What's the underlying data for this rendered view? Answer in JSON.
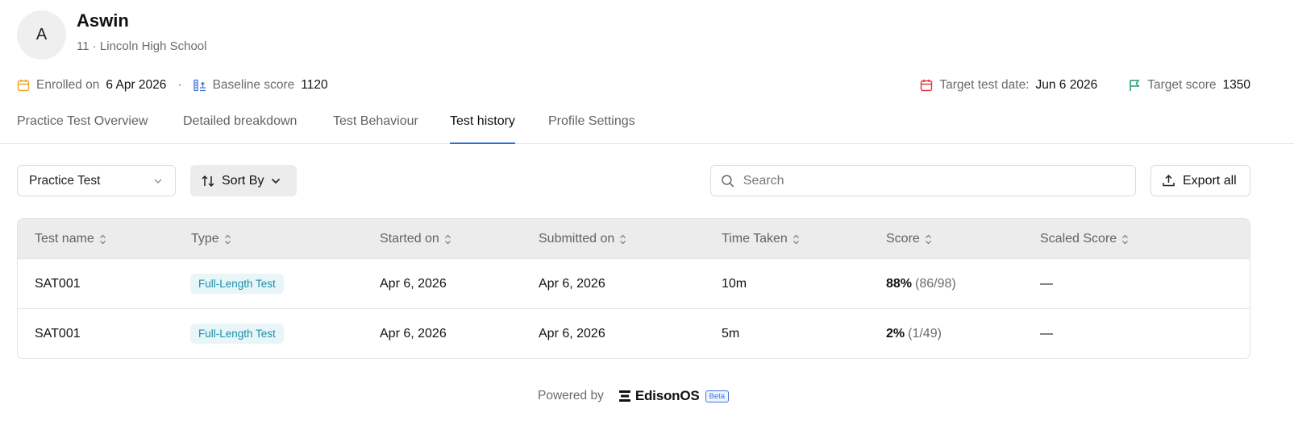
{
  "student": {
    "avatar_initial": "A",
    "name": "Aswin",
    "subtitle": "11 · Lincoln High School"
  },
  "meta": {
    "enrolled_label": "Enrolled on",
    "enrolled_value": "6 Apr 2026",
    "separator": "·",
    "baseline_label": "Baseline score",
    "baseline_value": "1120",
    "target_date_label": "Target test date:",
    "target_date_value": "Jun 6 2026",
    "target_score_label": "Target score",
    "target_score_value": "1350"
  },
  "tabs": [
    {
      "label": "Practice Test Overview",
      "active": false
    },
    {
      "label": "Detailed breakdown",
      "active": false
    },
    {
      "label": "Test Behaviour",
      "active": false
    },
    {
      "label": "Test history",
      "active": true
    },
    {
      "label": "Profile Settings",
      "active": false
    }
  ],
  "toolbar": {
    "filter_value": "Practice Test",
    "sort_label": "Sort By",
    "search_placeholder": "Search",
    "export_label": "Export all"
  },
  "table": {
    "columns": [
      "Test name",
      "Type",
      "Started on",
      "Submitted on",
      "Time Taken",
      "Score",
      "Scaled Score"
    ],
    "rows": [
      {
        "test_name": "SAT001",
        "type": "Full-Length Test",
        "started_on": "Apr 6, 2026",
        "submitted_on": "Apr 6, 2026",
        "time_taken": "10m",
        "score_pct": "88%",
        "score_frac": "(86/98)",
        "scaled_score": "—"
      },
      {
        "test_name": "SAT001",
        "type": "Full-Length Test",
        "started_on": "Apr 6, 2026",
        "submitted_on": "Apr 6, 2026",
        "time_taken": "5m",
        "score_pct": "2%",
        "score_frac": "(1/49)",
        "scaled_score": "—"
      }
    ]
  },
  "footer": {
    "powered_by": "Powered by",
    "brand": "EdisonOS",
    "badge": "Beta"
  },
  "colors": {
    "accent_tab": "#2e6fe0",
    "calendar_orange": "#f0a020",
    "calendar_red": "#e0303a",
    "flag_green": "#1a9a6a",
    "pill_bg": "#e8f6f9",
    "pill_text": "#1a8fa8"
  },
  "icons": [
    "calendar-icon",
    "baseline-chart-icon",
    "target-calendar-icon",
    "flag-icon",
    "chevron-down-icon",
    "sort-arrows-icon",
    "search-icon",
    "upload-icon",
    "column-sort-icon",
    "edisonos-logo-icon"
  ]
}
